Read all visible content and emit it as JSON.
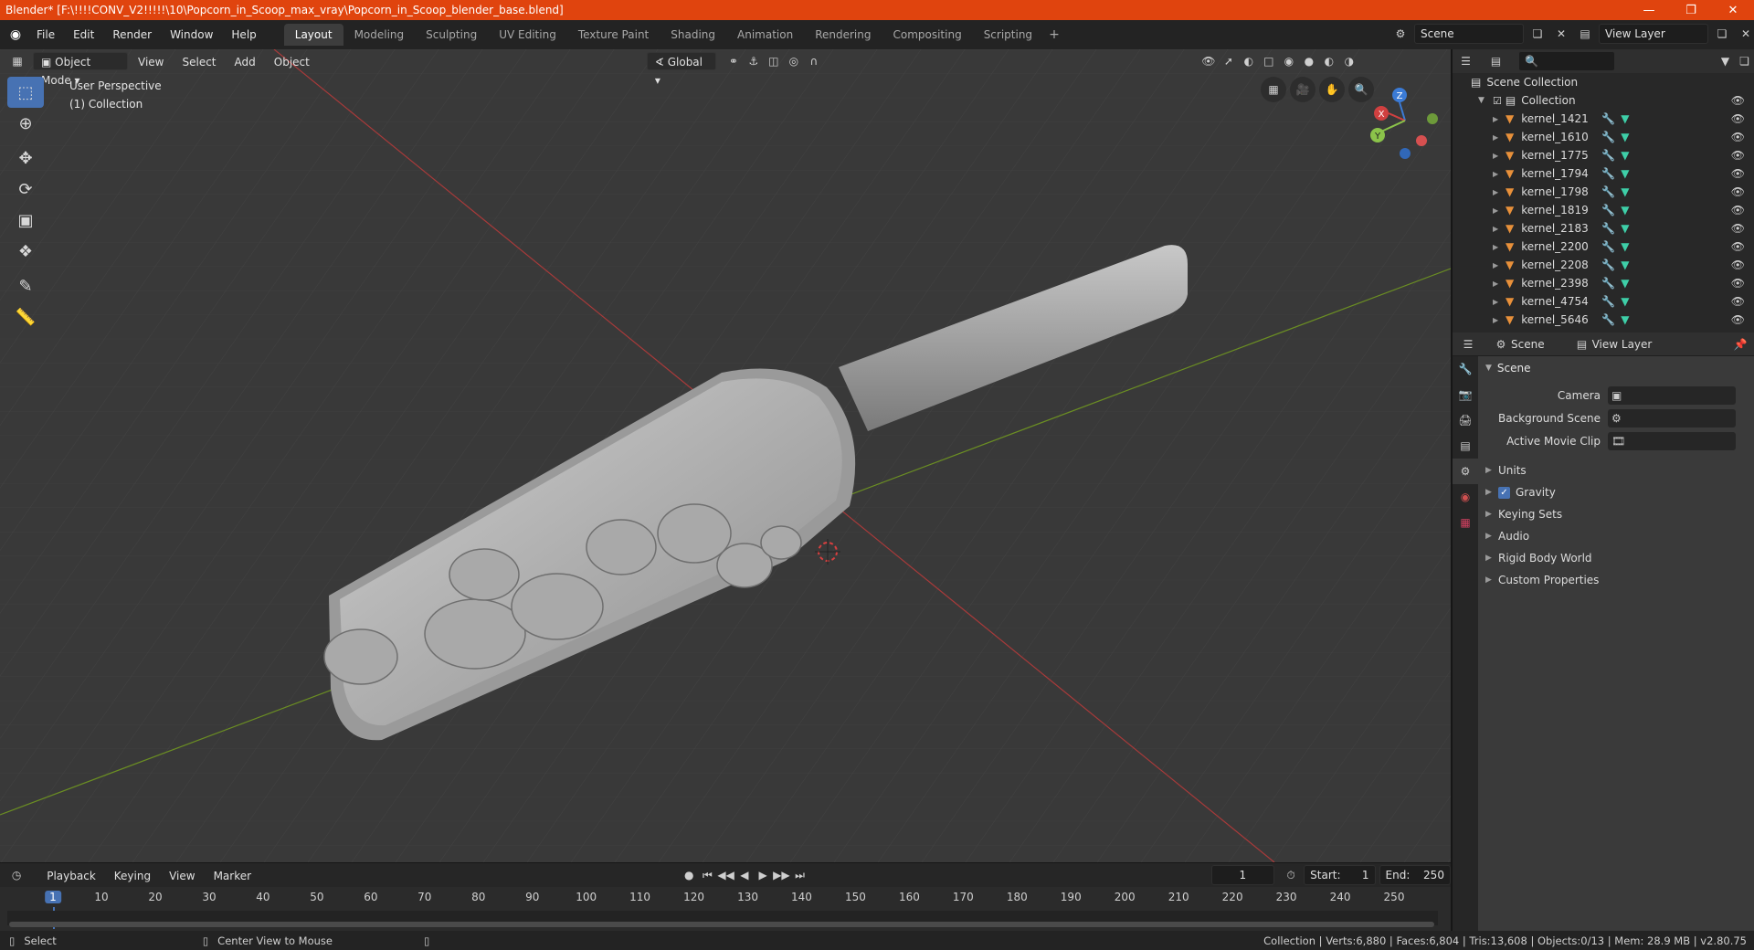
{
  "title": "Blender* [F:\\!!!!CONV_V2!!!!!\\10\\Popcorn_in_Scoop_max_vray\\Popcorn_in_Scoop_blender_base.blend]",
  "menu": [
    "File",
    "Edit",
    "Render",
    "Window",
    "Help"
  ],
  "workspaces": [
    "Layout",
    "Modeling",
    "Sculpting",
    "UV Editing",
    "Texture Paint",
    "Shading",
    "Animation",
    "Rendering",
    "Compositing",
    "Scripting"
  ],
  "active_workspace": "Layout",
  "scene_name": "Scene",
  "view_layer": "View Layer",
  "viewport": {
    "mode": "Object Mode",
    "menus": [
      "View",
      "Select",
      "Add",
      "Object"
    ],
    "orientation": "Global",
    "info_line1": "User Perspective",
    "info_line2": "(1) Collection"
  },
  "gizmo": {
    "x": "X",
    "y": "Y",
    "z": "Z"
  },
  "outliner": {
    "root": "Scene Collection",
    "collection": "Collection",
    "items": [
      "kernel_1421",
      "kernel_1610",
      "kernel_1775",
      "kernel_1794",
      "kernel_1798",
      "kernel_1819",
      "kernel_2183",
      "kernel_2200",
      "kernel_2208",
      "kernel_2398",
      "kernel_4754",
      "kernel_5646"
    ]
  },
  "properties": {
    "tab_scene": "Scene",
    "tab_view_layer": "View Layer",
    "panel": "Scene",
    "camera_label": "Camera",
    "bg_scene_label": "Background Scene",
    "movie_clip_label": "Active Movie Clip",
    "subpanels": [
      "Units",
      "Gravity",
      "Keying Sets",
      "Audio",
      "Rigid Body World",
      "Custom Properties"
    ]
  },
  "timeline": {
    "menus": [
      "Playback",
      "Keying",
      "View",
      "Marker"
    ],
    "current_frame": "1",
    "start_label": "Start:",
    "start": "1",
    "end_label": "End:",
    "end": "250",
    "ticks": [
      "1",
      "10",
      "20",
      "30",
      "40",
      "50",
      "60",
      "70",
      "80",
      "90",
      "100",
      "110",
      "120",
      "130",
      "140",
      "150",
      "160",
      "170",
      "180",
      "190",
      "200",
      "210",
      "220",
      "230",
      "240",
      "250"
    ]
  },
  "status": {
    "left": "Select",
    "mid": "Center View to Mouse",
    "right": "Collection | Verts:6,880 | Faces:6,804 | Tris:13,608 | Objects:0/13 | Mem: 28.9 MB | v2.80.75"
  }
}
